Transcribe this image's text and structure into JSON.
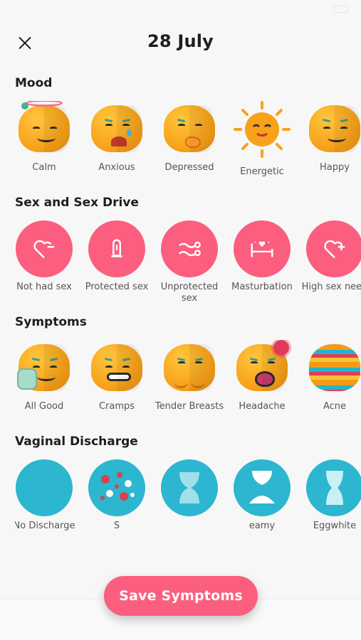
{
  "header": {
    "title": "28 July"
  },
  "sections": {
    "mood": {
      "title": "Mood",
      "items": [
        {
          "label": "Calm",
          "icon": "calm-face-icon"
        },
        {
          "label": "Anxious",
          "icon": "anxious-face-icon"
        },
        {
          "label": "Depressed",
          "icon": "depressed-face-icon"
        },
        {
          "label": "Energetic",
          "icon": "sun-face-icon"
        },
        {
          "label": "Happy",
          "icon": "happy-face-icon"
        }
      ]
    },
    "sex": {
      "title": "Sex and Sex Drive",
      "items": [
        {
          "label": "Not had sex",
          "icon": "heart-minus-icon"
        },
        {
          "label": "Protected sex",
          "icon": "condom-icon"
        },
        {
          "label": "Unprotected sex",
          "icon": "unprotected-icon"
        },
        {
          "label": "Masturbation",
          "icon": "bed-heart-icon"
        },
        {
          "label": "High sex need",
          "icon": "heart-plus-icon"
        }
      ]
    },
    "symptoms": {
      "title": "Symptoms",
      "items": [
        {
          "label": "All Good",
          "icon": "thumbs-up-face-icon"
        },
        {
          "label": "Cramps",
          "icon": "cramps-face-icon"
        },
        {
          "label": "Tender Breasts",
          "icon": "breasts-face-icon"
        },
        {
          "label": "Headache",
          "icon": "headache-face-icon"
        },
        {
          "label": "Acne",
          "icon": "acne-face-icon"
        }
      ]
    },
    "discharge": {
      "title": "Vaginal Discharge",
      "items": [
        {
          "label": "No Discharge",
          "icon": "no-discharge-icon"
        },
        {
          "label": "S",
          "icon": "spotting-icon"
        },
        {
          "label": "",
          "icon": "hourglass-icon"
        },
        {
          "label": "eamy",
          "icon": "creamy-icon"
        },
        {
          "label": "Eggwhite",
          "icon": "eggwhite-icon"
        }
      ]
    }
  },
  "actions": {
    "save_label": "Save Symptoms"
  },
  "colors": {
    "accent": "#fb5e7e",
    "discharge": "#2cb6cf",
    "face": "#f7a21b"
  }
}
